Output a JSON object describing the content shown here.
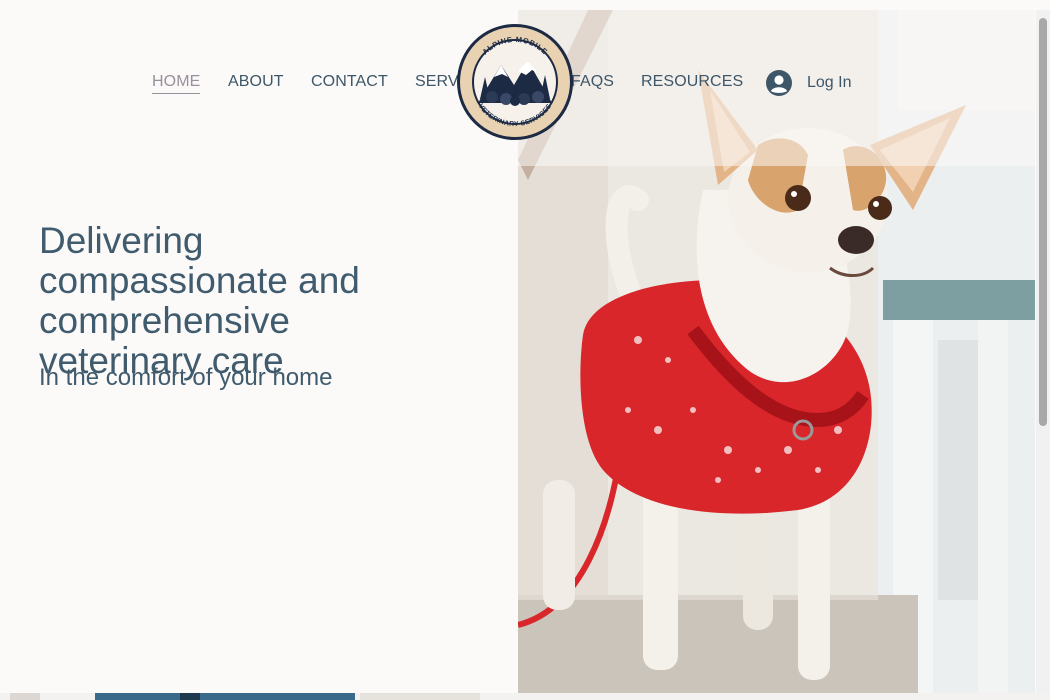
{
  "nav": {
    "items": [
      {
        "label": "HOME"
      },
      {
        "label": "ABOUT"
      },
      {
        "label": "CONTACT"
      },
      {
        "label": "SERVICES"
      },
      {
        "label": "FAQS"
      },
      {
        "label": "RESOURCES"
      }
    ],
    "login_label": "Log In"
  },
  "logo": {
    "top_text": "ALPINE MOBILE",
    "bottom_text": "VETERINARY SERVICES"
  },
  "hero": {
    "headline": "Delivering compassionate and comprehensive veterinary care",
    "subheadline": "In the comfort of your home"
  },
  "colors": {
    "text": "#3f5b6d",
    "active_nav": "#9a8f9c",
    "background": "#fbfaf8",
    "sweater_red": "#d8262b"
  }
}
